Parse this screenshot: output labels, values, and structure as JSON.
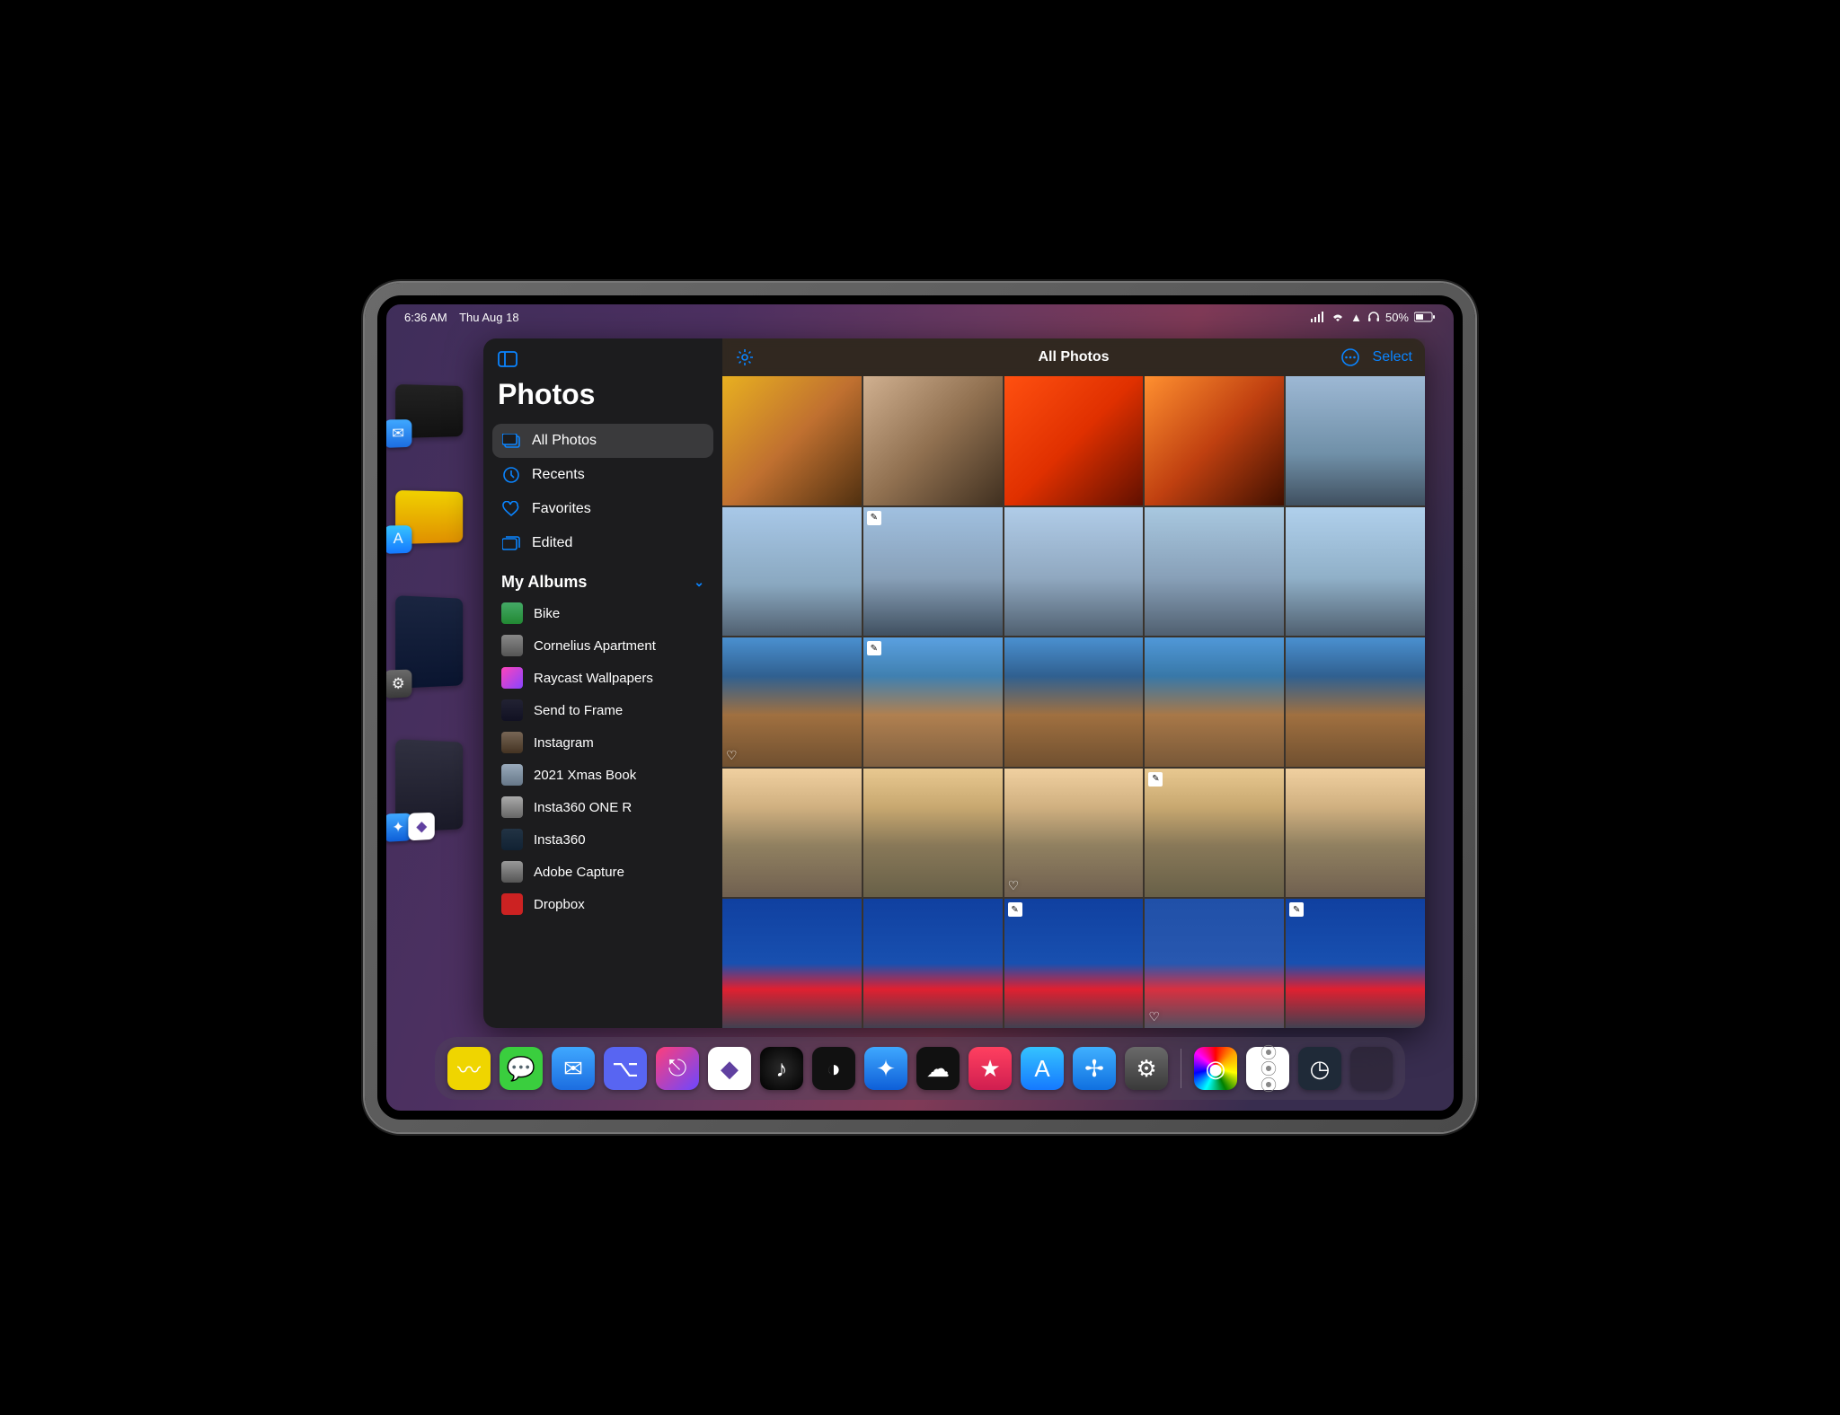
{
  "status": {
    "time": "6:36 AM",
    "date": "Thu Aug 18",
    "battery": "50%"
  },
  "app": {
    "title": "Photos",
    "content_title": "All Photos",
    "select_label": "Select"
  },
  "sidebar": {
    "items": [
      {
        "label": "All Photos",
        "icon": "photos"
      },
      {
        "label": "Recents",
        "icon": "clock"
      },
      {
        "label": "Favorites",
        "icon": "heart"
      },
      {
        "label": "Edited",
        "icon": "stack"
      }
    ],
    "section_label": "My Albums",
    "albums": [
      {
        "label": "Bike"
      },
      {
        "label": "Cornelius Apartment"
      },
      {
        "label": "Raycast Wallpapers"
      },
      {
        "label": "Send to Frame"
      },
      {
        "label": "Instagram"
      },
      {
        "label": "2021 Xmas Book"
      },
      {
        "label": "Insta360 ONE R"
      },
      {
        "label": "Insta360"
      },
      {
        "label": "Adobe Capture"
      },
      {
        "label": "Dropbox"
      }
    ]
  },
  "thumbs": [
    {
      "bg": "linear-gradient(135deg,#e8b020,#c07030,#503010)",
      "edit": false,
      "fav": false
    },
    {
      "bg": "linear-gradient(135deg,#d0b090,#907050,#403020)",
      "edit": false,
      "fav": false
    },
    {
      "bg": "linear-gradient(135deg,#ff5010,#e03000,#601000)",
      "edit": false,
      "fav": false
    },
    {
      "bg": "linear-gradient(135deg,#ff9030,#c04010,#401000)",
      "edit": false,
      "fav": false
    },
    {
      "bg": "linear-gradient(180deg,#9db8d4,#7090a8 60%,#405060)",
      "edit": false,
      "fav": false
    },
    {
      "bg": "linear-gradient(180deg,#a8c8e8,#8aa8c0 60%,#506070)",
      "edit": false,
      "fav": false
    },
    {
      "bg": "linear-gradient(180deg,#a0c0e0,#88a0b8 55%,#405060)",
      "edit": true,
      "fav": false
    },
    {
      "bg": "linear-gradient(180deg,#b0cce8,#90a8c0 55%,#506070)",
      "edit": false,
      "fav": false
    },
    {
      "bg": "linear-gradient(180deg,#a8c8e0,#88a0b8 55%,#506070)",
      "edit": false,
      "fav": false
    },
    {
      "bg": "linear-gradient(180deg,#b0d0ec,#90b0c8 55%,#506070)",
      "edit": false,
      "fav": false
    },
    {
      "bg": "linear-gradient(180deg,#4a90d0,#306090 30%,#a07040 60%,#705030)",
      "edit": false,
      "fav": true
    },
    {
      "bg": "linear-gradient(180deg,#5aa0e0,#4080b0 30%,#b08050 60%,#806040)",
      "edit": true,
      "fav": false
    },
    {
      "bg": "linear-gradient(180deg,#4a90d0,#306090 30%,#a07040 60%,#705030)",
      "edit": false,
      "fav": false
    },
    {
      "bg": "linear-gradient(180deg,#5098d8,#3878a8 30%,#a87848 60%,#785838)",
      "edit": false,
      "fav": false
    },
    {
      "bg": "linear-gradient(180deg,#4a90d0,#306090 30%,#a07040 60%,#705030)",
      "edit": false,
      "fav": false
    },
    {
      "bg": "linear-gradient(180deg,#f0d0a0,#d0b080 30%,#908060 60%,#706050)",
      "edit": false,
      "fav": false
    },
    {
      "bg": "linear-gradient(180deg,#e8c890,#c8a870 30%,#887858 60%,#686048)",
      "edit": false,
      "fav": false
    },
    {
      "bg": "linear-gradient(180deg,#f0d0a0,#d0b080 30%,#908060 60%,#706050)",
      "edit": false,
      "fav": true
    },
    {
      "bg": "linear-gradient(180deg,#e8c890,#c8a870 30%,#887858 60%,#686048)",
      "edit": true,
      "fav": false
    },
    {
      "bg": "linear-gradient(180deg,#f0d0a0,#d0b080 30%,#908060 60%,#706050)",
      "edit": false,
      "fav": false
    },
    {
      "bg": "linear-gradient(180deg,#1040a0,#1850b0 50%,#e02030 70%,#404050)",
      "edit": false,
      "fav": false
    },
    {
      "bg": "linear-gradient(180deg,#1040a0,#1850b0 50%,#e02030 70%,#404050)",
      "edit": false,
      "fav": false
    },
    {
      "bg": "linear-gradient(180deg,#1040a0,#1850b0 50%,#e02030 70%,#404050)",
      "edit": true,
      "fav": false
    },
    {
      "bg": "linear-gradient(180deg,#2050a8,#2858b0 50%,#d83040 70%,#505060)",
      "edit": false,
      "fav": true
    },
    {
      "bg": "linear-gradient(180deg,#1040a0,#1850b0 50%,#e02030 70%,#404050)",
      "edit": true,
      "fav": false
    }
  ],
  "dock": {
    "main": [
      {
        "name": "craft",
        "bg": "#efd500"
      },
      {
        "name": "messages",
        "bg": "#3ace3e"
      },
      {
        "name": "mail",
        "bg": "linear-gradient(#3fa8ff,#1c6de0)"
      },
      {
        "name": "discord",
        "bg": "#5865F2"
      },
      {
        "name": "shortcuts",
        "bg": "linear-gradient(135deg,#ff3e7a,#6c47ff)"
      },
      {
        "name": "obsidian",
        "bg": "#fff"
      },
      {
        "name": "music",
        "bg": "radial-gradient(circle,#2a2a2a,#000)"
      },
      {
        "name": "activity",
        "bg": "#111"
      },
      {
        "name": "safari",
        "bg": "linear-gradient(#3fa8ff,#0e5fd8)"
      },
      {
        "name": "icloud",
        "bg": "#111"
      },
      {
        "name": "star",
        "bg": "linear-gradient(#ff4060,#d01e50)"
      },
      {
        "name": "appstore",
        "bg": "linear-gradient(#35c3ff,#1579ff)"
      },
      {
        "name": "atlas",
        "bg": "linear-gradient(#40b0ff,#1070e0)"
      },
      {
        "name": "settings",
        "bg": "linear-gradient(#6a6a6a,#3a3a3a)"
      }
    ],
    "recent": [
      {
        "name": "color",
        "bg": "#fff"
      },
      {
        "name": "reminders",
        "bg": "#fff"
      },
      {
        "name": "speedtest",
        "bg": "#1f2a38"
      }
    ]
  }
}
